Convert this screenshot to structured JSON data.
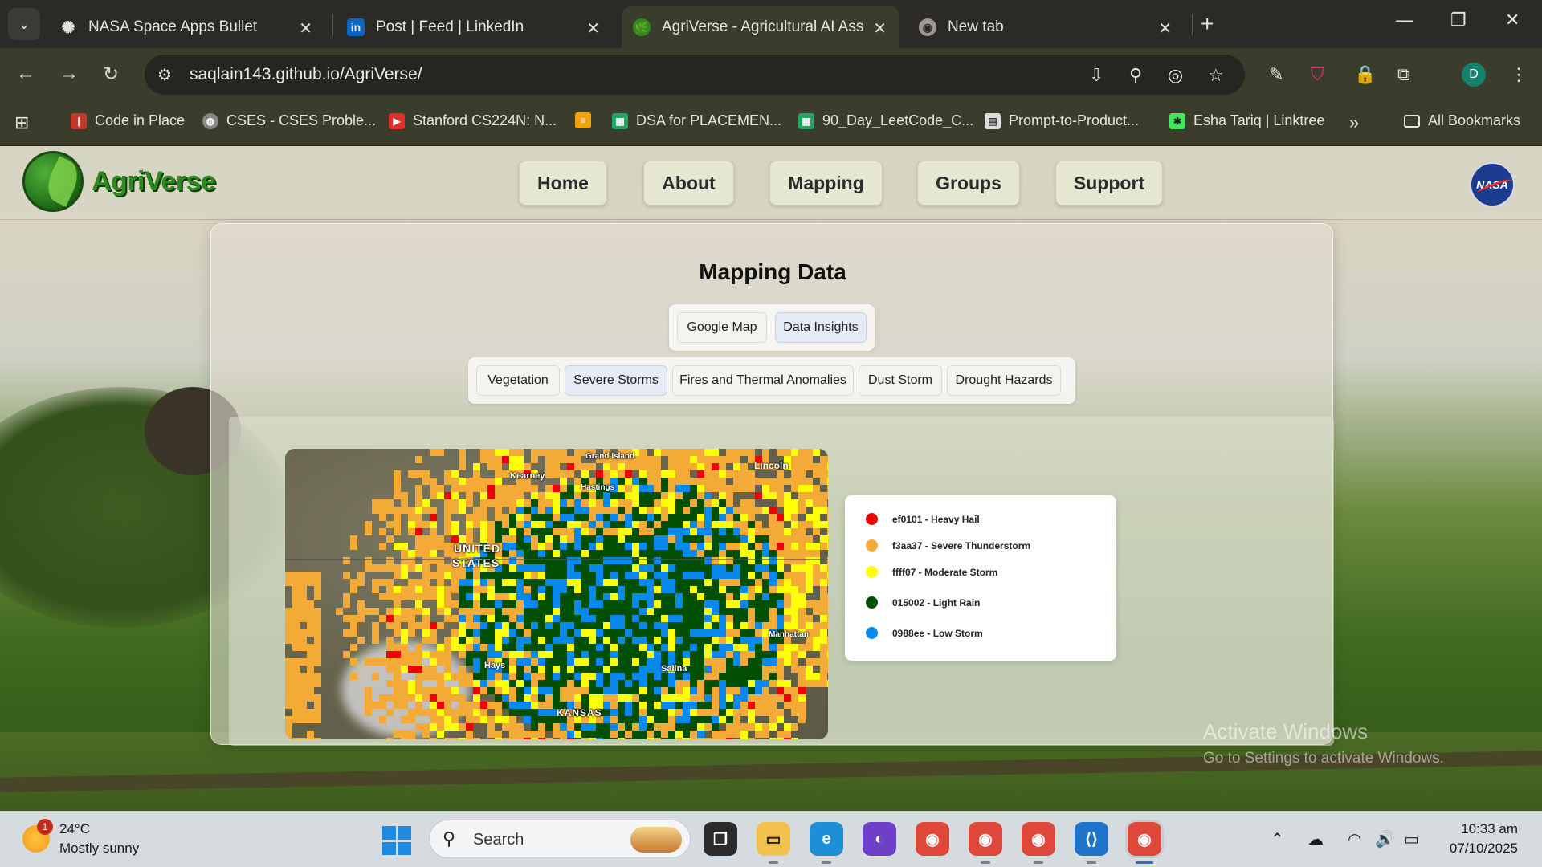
{
  "browser": {
    "tabs": [
      {
        "title": "NASA Space Apps Bullet",
        "icon": "openai-icon"
      },
      {
        "title": "Post | Feed | LinkedIn",
        "icon": "linkedin-icon"
      },
      {
        "title": "AgriVerse - Agricultural AI Assis",
        "icon": "agriverse-icon",
        "active": true
      },
      {
        "title": "New tab",
        "icon": "chrome-icon"
      }
    ],
    "url": "saqlain143.github.io/AgriVerse/",
    "profile_initial": "D",
    "bookmarks": [
      {
        "label": "Code in Place",
        "color": "#c0392b"
      },
      {
        "label": "CSES - CSES Proble...",
        "color": "#888888"
      },
      {
        "label": "Stanford CS224N: N...",
        "color": "#e52d27"
      },
      {
        "label": "",
        "color": "#f2a20c"
      },
      {
        "label": "DSA for PLACEMEN...",
        "color": "#23a566"
      },
      {
        "label": "90_Day_LeetCode_C...",
        "color": "#23a566"
      },
      {
        "label": "Prompt-to-Product...",
        "color": "#dddddd"
      },
      {
        "label": "Esha Tariq | Linktree",
        "color": "#43e55e"
      }
    ],
    "all_bookmarks": "All Bookmarks"
  },
  "site": {
    "brand": "AgriVerse",
    "nav": [
      "Home",
      "About",
      "Mapping",
      "Groups",
      "Support"
    ],
    "nasa_logo": "NASA"
  },
  "mapping": {
    "title": "Mapping Data",
    "view_tabs": [
      "Google Map",
      "Data Insights"
    ],
    "active_view": "Data Insights",
    "layer_tabs": [
      "Vegetation",
      "Severe Storms",
      "Fires and Thermal Anomalies",
      "Dust Storm",
      "Drought Hazards"
    ],
    "active_layer": "Severe Storms",
    "map_labels": {
      "grand_island": "Grand Island",
      "kearney": "Kearney",
      "hastings": "Hastings",
      "lincoln": "Lincoln",
      "united": "UNITED",
      "states": "STATES",
      "manhattan": "Manhattan",
      "hays": "Hays",
      "salina": "Salina",
      "kansas": "KANSAS"
    },
    "legend": [
      {
        "label": "ef0101 - Heavy Hail",
        "color": "#ef0101"
      },
      {
        "label": "f3aa37 - Severe Thunderstorm",
        "color": "#f3aa37"
      },
      {
        "label": "ffff07 - Moderate Storm",
        "color": "#ffff07"
      },
      {
        "label": "015002 - Light Rain",
        "color": "#015002"
      },
      {
        "label": "0988ee - Low Storm",
        "color": "#0988ee"
      }
    ]
  },
  "watermark": {
    "line1": "Activate Windows",
    "line2": "Go to Settings to activate Windows."
  },
  "taskbar": {
    "weather_temp": "24°C",
    "weather_desc": "Mostly sunny",
    "notification_count": "1",
    "search_placeholder": "Search",
    "time": "10:33 am",
    "date": "07/10/2025"
  }
}
